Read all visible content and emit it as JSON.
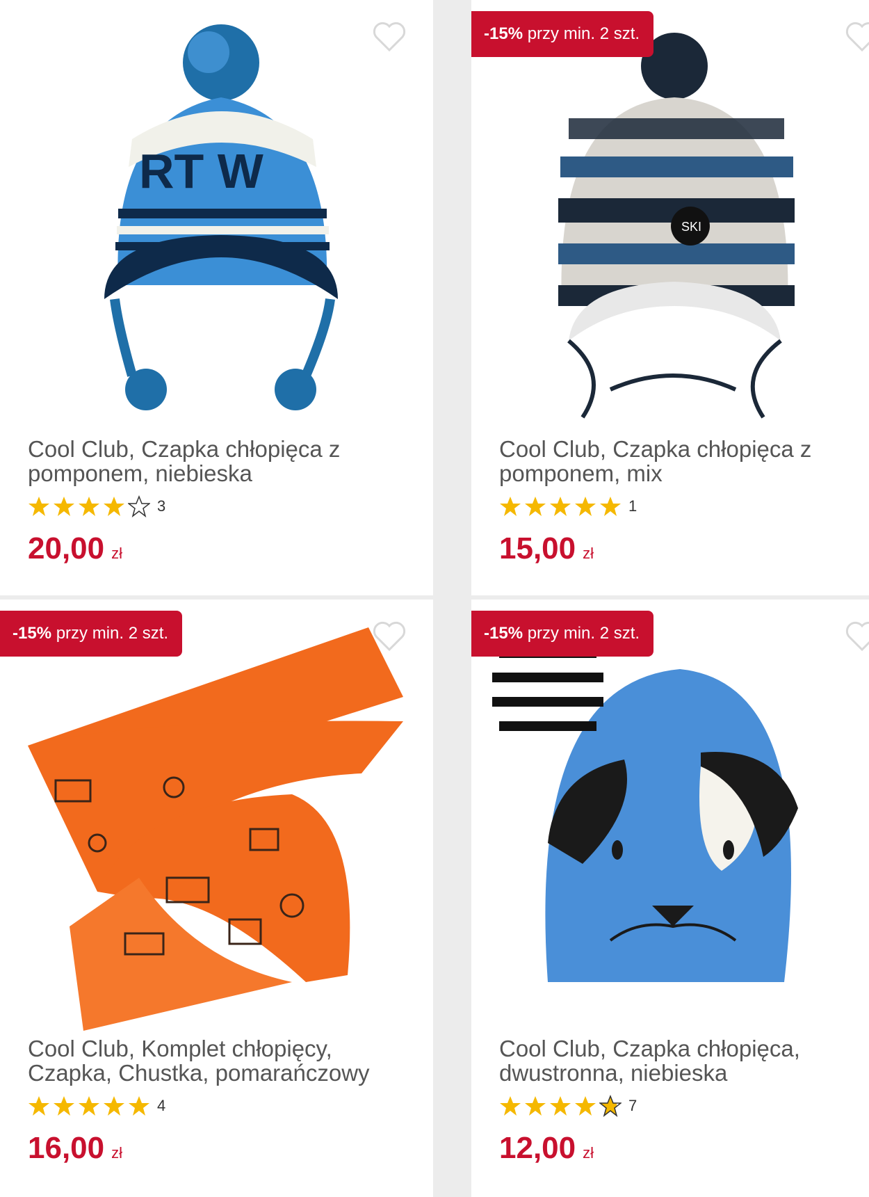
{
  "products": [
    {
      "title_line1": "Cool Club, Czapka chłopięca z",
      "title_line2": "pomponem, niebieska",
      "rating_count": "3",
      "rating": 4,
      "price": "20,00",
      "currency": "zł",
      "badge": null,
      "image_icon": "blue-knit-hat-with-pompom-image"
    },
    {
      "title_line1": "Cool Club, Czapka chłopięca z",
      "title_line2": "pomponem, mix",
      "rating_count": "1",
      "rating": 5,
      "price": "15,00",
      "currency": "zł",
      "badge": {
        "pct": "-15%",
        "text": " przy min. 2 szt."
      },
      "image_icon": "striped-knit-hat-image"
    },
    {
      "title_line1": "Cool Club, Komplet chłopięcy,",
      "title_line2": "Czapka, Chustka, pomarańczowy",
      "rating_count": "4",
      "rating": 5,
      "price": "16,00",
      "currency": "zł",
      "badge": {
        "pct": "-15%",
        "text": " przy min. 2 szt."
      },
      "image_icon": "orange-hat-scarf-set-image"
    },
    {
      "title_line1": "Cool Club, Czapka chłopięca,",
      "title_line2": "dwustronna, niebieska",
      "rating_count": "7",
      "rating": 4.8,
      "price": "12,00",
      "currency": "zł",
      "badge": {
        "pct": "-15%",
        "text": " przy min. 2 szt."
      },
      "image_icon": "blue-dog-face-hat-image"
    }
  ],
  "colors": {
    "accent": "#c8102e",
    "star": "#f5b800",
    "title": "#555555"
  }
}
